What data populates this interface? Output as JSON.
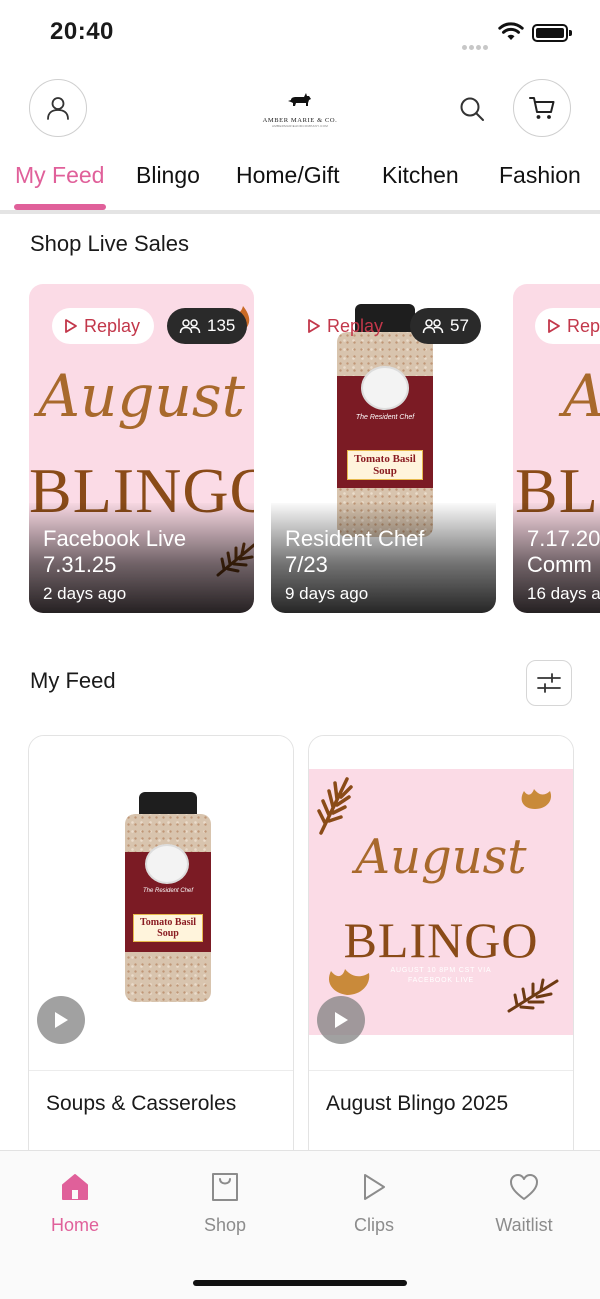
{
  "status_bar": {
    "time": "20:40"
  },
  "header": {
    "logo_text": "AMBER MARIE & CO.",
    "logo_subtext": "AMBERMARIEANDCOMPANY.COM"
  },
  "tabs": [
    {
      "label": "My Feed",
      "active": true
    },
    {
      "label": "Blingo",
      "active": false
    },
    {
      "label": "Home/Gift",
      "active": false
    },
    {
      "label": "Kitchen",
      "active": false
    },
    {
      "label": "Fashion",
      "active": false
    }
  ],
  "live_section": {
    "title": "Shop Live Sales",
    "cards": [
      {
        "replay_label": "Replay",
        "viewers": "135",
        "title_line1": "Facebook Live",
        "title_line2": "7.31.25",
        "time": "2 days ago",
        "art_script": "August",
        "art_word": "BLINGO"
      },
      {
        "replay_label": "Replay",
        "viewers": "57",
        "title_line1": "Resident Chef",
        "title_line2": "7/23",
        "time": "9 days ago",
        "jar_band": "Tomato Basil Soup",
        "jar_brand": "The Resident Chef"
      },
      {
        "replay_label": "Replay",
        "title_line1": "7.17.20",
        "title_line2": "Comm",
        "time": "16 days a",
        "art_script": "A",
        "art_word": "BLI"
      }
    ]
  },
  "feed_section": {
    "title": "My Feed",
    "cards": [
      {
        "title": "Soups & Casseroles",
        "jar_band": "Tomato Basil Soup",
        "jar_brand": "The Resident Chef"
      },
      {
        "title": "August Blingo 2025",
        "art_script": "August",
        "art_word": "BLINGO",
        "art_caption": "AUGUST 10 8PM CST VIA FACEBOOK LIVE"
      }
    ]
  },
  "bottom_nav": [
    {
      "label": "Home",
      "icon": "home-icon",
      "active": true
    },
    {
      "label": "Shop",
      "icon": "shopping-bag-icon",
      "active": false
    },
    {
      "label": "Clips",
      "icon": "play-icon",
      "active": false
    },
    {
      "label": "Waitlist",
      "icon": "heart-icon",
      "active": false
    }
  ],
  "colors": {
    "accent": "#e0609a",
    "replay_text": "#c2374a",
    "card_pink": "#fbdbe6",
    "jar_label": "#7b1b24"
  }
}
